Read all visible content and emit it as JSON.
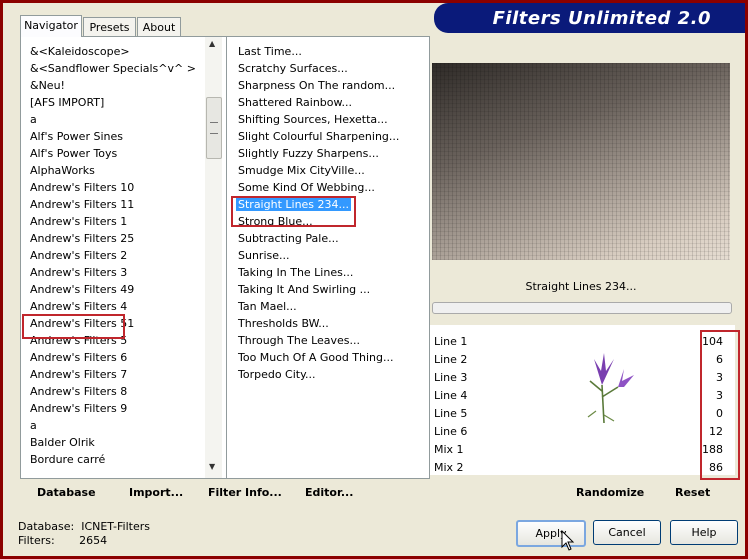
{
  "window": {
    "title": "Filters Unlimited 2.0"
  },
  "tabs": [
    "Navigator",
    "Presets",
    "About"
  ],
  "categories": [
    "&<Kaleidoscope>",
    "&<Sandflower Specials^v^ >",
    "&Neu!",
    "[AFS IMPORT]",
    "a",
    "Alf's Power Sines",
    "Alf's Power Toys",
    "AlphaWorks",
    "Andrew's Filters 10",
    "Andrew's Filters 11",
    "Andrew's Filters 1",
    "Andrew's Filters 25",
    "Andrew's Filters 2",
    "Andrew's Filters 3",
    "Andrew's Filters 49",
    "Andrew's Filters 4",
    "Andrew's Filters 51",
    "Andrew's Filters 5",
    "Andrew's Filters 6",
    "Andrew's Filters 7",
    "Andrew's Filters 8",
    "Andrew's Filters 9",
    "a",
    "Balder Olrik",
    "Bordure carré"
  ],
  "selected_category": "Andrew's Filters 51",
  "filters": [
    "Last Time...",
    "Scratchy Surfaces...",
    "Sharpness On The random...",
    "Shattered Rainbow...",
    "Shifting Sources, Hexetta...",
    "Slight Colourful Sharpening...",
    "Slightly Fuzzy Sharpens...",
    "Smudge Mix CityVille...",
    "Some Kind Of Webbing...",
    "Straight Lines 234...",
    "Strong Blue...",
    "Subtracting Pale...",
    "Sunrise...",
    "Taking In The Lines...",
    "Taking It And Swirling ...",
    "Tan Mael...",
    "Thresholds BW...",
    "Through The Leaves...",
    "Too Much Of A Good Thing...",
    "Torpedo City..."
  ],
  "selected_filter": "Straight Lines 234...",
  "preview": {
    "filter_name": "Straight Lines 234..."
  },
  "params": [
    {
      "label": "Line 1",
      "value": "104"
    },
    {
      "label": "Line 2",
      "value": "6"
    },
    {
      "label": "Line 3",
      "value": "3"
    },
    {
      "label": "Line 4",
      "value": "3"
    },
    {
      "label": "Line 5",
      "value": "0"
    },
    {
      "label": "Line 6",
      "value": "12"
    },
    {
      "label": "Mix 1",
      "value": "188"
    },
    {
      "label": "Mix 2",
      "value": "86"
    }
  ],
  "buttons": {
    "database": "Database",
    "import": "Import...",
    "filter_info": "Filter Info...",
    "editor": "Editor...",
    "randomize": "Randomize",
    "reset": "Reset",
    "apply": "Apply",
    "cancel": "Cancel",
    "help": "Help"
  },
  "status": {
    "database_label": "Database:",
    "database_value": "ICNET-Filters",
    "filters_label": "Filters:",
    "filters_value": "2654"
  },
  "colors": {
    "frame": "#8b0000",
    "title_bg": "#0a1a7a",
    "highlight": "#3399ff",
    "annotation_red": "#c0262c"
  }
}
